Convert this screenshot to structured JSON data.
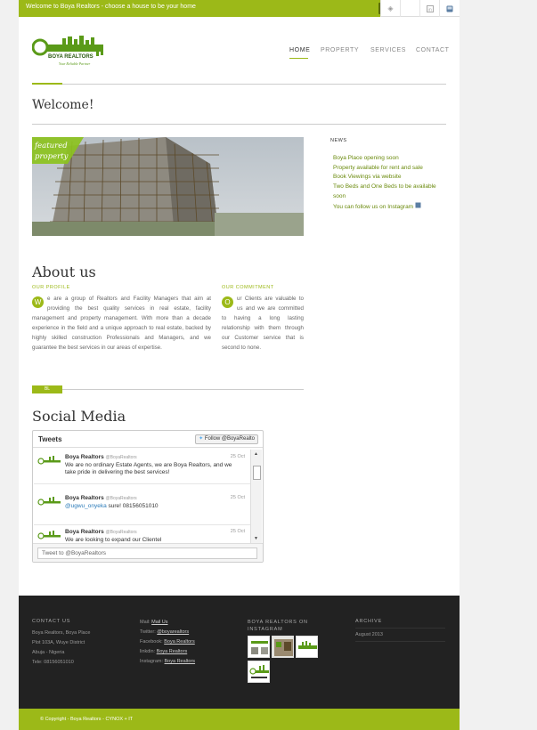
{
  "topbar": {
    "welcome_text": "Welcome to Boya Realtors - choose a house to be your home",
    "close_label": "close"
  },
  "nav": {
    "items": [
      "HOME",
      "PROPERTY",
      "SERVICES",
      "CONTACT"
    ]
  },
  "logo": {
    "name": "BOYA REALTORS",
    "tagline": "Your Reliable Partner"
  },
  "welcome_title": "Welcome!",
  "featured": {
    "ribbon_line1": "featured",
    "ribbon_line2": "property"
  },
  "news": {
    "title": "NEWS",
    "items": [
      "Boya Place opening soon",
      "Property available for rent and sale",
      "Book Viewings via website",
      "Two Beds and One Beds to be available soon",
      "You can follow us on Instagram"
    ]
  },
  "about": {
    "title": "About us",
    "profile_label": "OUR PROFILE",
    "profile_dropcap": "W",
    "profile_text": "e are a group of Realtors and Facility Managers that aim at providing the best quality services in real estate, facility management and property management. With more than a decade experience in the field and a unique approach to real estate, backed by highly skilled construction Professionals and Managers, and we guarantee the best services in our areas of expertise.",
    "commitment_label": "OUR COMMITMENT",
    "commitment_dropcap": "O",
    "commitment_text": "ur Clients are valuable to us and we are committed to having a long lasting relationship with them through our Customer service that is second to none.",
    "tag": "BL"
  },
  "social": {
    "title": "Social Media",
    "widget_title": "Tweets",
    "follow_label": "Follow @BoyaRealto",
    "tweets": [
      {
        "name": "Boya Realtors",
        "handle": "@BoyaRealtors",
        "date": "25 Oct",
        "text": "We are no ordinary Estate Agents, we are Boya Realtors, and we take pride in delivering the best services!"
      },
      {
        "name": "Boya Realtors",
        "handle": "@BoyaRealtors",
        "date": "25 Oct",
        "mention": "@ugwu_onyeka",
        "text": " sure! 08156051010"
      },
      {
        "name": "Boya Realtors",
        "handle": "@BoyaRealtors",
        "date": "25 Oct",
        "text": "We are looking to expand our Clientel"
      }
    ],
    "tweet_placeholder": "Tweet to @BoyaRealtors"
  },
  "footer": {
    "contact_title": "CONTACT US",
    "contact_lines": [
      "Boya Realtors, Boya Place",
      "Plot 103A, Wuye District",
      "Abuja - Nigeria",
      "Tele: 08156051010"
    ],
    "links": [
      {
        "label": "Mail:",
        "value": "Mail Us"
      },
      {
        "label": "Twitter:",
        "value": "@boyarealtors"
      },
      {
        "label": "Facebook:",
        "value": "Boya Realtors"
      },
      {
        "label": "linkdin:",
        "value": "Boya Realtors"
      },
      {
        "label": "Instagram:",
        "value": "Boya Realtors"
      }
    ],
    "instagram_title": "BOYA REALTORS ON INSTAGRAM",
    "archive_title": "ARCHIVE",
    "archive_items": [
      "August 2013"
    ]
  },
  "copyright": {
    "prefix": "© Copyright - ",
    "site": "Boya Realtors",
    "sep": " - ",
    "credit": "CYNOX + IT"
  },
  "colors": {
    "accent": "#9cb918",
    "footer": "#222222"
  }
}
